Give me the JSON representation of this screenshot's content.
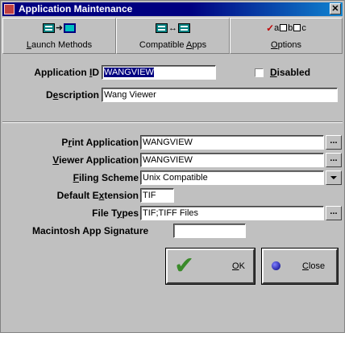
{
  "window": {
    "title": "Application Maintenance",
    "close_glyph": "✕"
  },
  "toolbar": {
    "launch": {
      "label_pre": "",
      "label_u": "L",
      "label_post": "aunch Methods",
      "icon": "launch-methods-icon"
    },
    "compatible": {
      "label_pre": "Compatible ",
      "label_u": "A",
      "label_post": "pps",
      "icon": "compatible-apps-icon"
    },
    "options": {
      "label_pre": "",
      "label_u": "O",
      "label_post": "ptions",
      "icon": "options-icon",
      "glyphs": [
        "a",
        "b",
        "c"
      ]
    }
  },
  "form": {
    "app_id": {
      "label_pre": "Application ",
      "label_u": "I",
      "label_post": "D",
      "value": "WANGVIEW"
    },
    "disabled": {
      "label_u": "D",
      "label_post": "isabled",
      "checked": false
    },
    "description": {
      "label_pre": "D",
      "label_u": "e",
      "label_post": "scription",
      "value": "Wang Viewer"
    },
    "print_app": {
      "label_pre": "P",
      "label_u": "r",
      "label_post": "int Application",
      "value": "WANGVIEW"
    },
    "viewer_app": {
      "label_pre": "",
      "label_u": "V",
      "label_post": "iewer Application",
      "value": "WANGVIEW"
    },
    "filing_scheme": {
      "label_pre": "",
      "label_u": "F",
      "label_post": "iling Scheme",
      "value": "Unix Compatible"
    },
    "default_ext": {
      "label_pre": "Default E",
      "label_u": "x",
      "label_post": "tension",
      "value": "TIF"
    },
    "file_types": {
      "label_pre": "File T",
      "label_u": "y",
      "label_post": "pes",
      "value": "TIF;TIFF Files"
    },
    "mac_sig": {
      "label": "Macintosh App Signature",
      "value": ""
    },
    "ellipsis": "..."
  },
  "buttons": {
    "ok": {
      "label_u": "O",
      "label_post": "K"
    },
    "close": {
      "label_u": "C",
      "label_post": "lose"
    }
  },
  "colors": {
    "titlebar": "#000080",
    "selection": "#000080",
    "check": "#3a8a2a"
  }
}
